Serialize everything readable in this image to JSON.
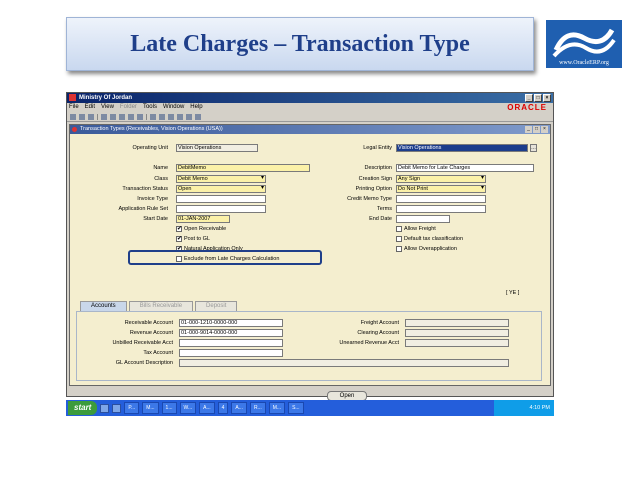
{
  "slide": {
    "title": "Late Charges – Transaction Type",
    "logo_text": "www.OracleERP.org"
  },
  "window": {
    "title": "Ministry Of Jordan",
    "menu": [
      "File",
      "Edit",
      "View",
      "Folder",
      "Tools",
      "Window",
      "Help"
    ],
    "brand": "ORACLE"
  },
  "form": {
    "title": "Transaction Types (Receivables, Vision Operations (USA))",
    "operating_unit": {
      "label": "Operating Unit",
      "value": "Vision Operations"
    },
    "legal_entity": {
      "label": "Legal Entity",
      "value": "Vision Operations"
    },
    "name": {
      "label": "Name",
      "value": "DebitMemo"
    },
    "class": {
      "label": "Class",
      "value": "Debit Memo"
    },
    "transaction_status": {
      "label": "Transaction Status",
      "value": "Open"
    },
    "invoice_type": {
      "label": "Invoice Type",
      "value": ""
    },
    "application_rule_set": {
      "label": "Application Rule Set",
      "value": ""
    },
    "start_date": {
      "label": "Start Date",
      "value": "01-JAN-2007"
    },
    "description": {
      "label": "Description",
      "value": "Debit Memo for Late Charges"
    },
    "creation_sign": {
      "label": "Creation Sign",
      "value": "Any Sign"
    },
    "printing_option": {
      "label": "Printing Option",
      "value": "Do Not Print"
    },
    "credit_memo_type": {
      "label": "Credit Memo Type",
      "value": ""
    },
    "terms": {
      "label": "Terms",
      "value": ""
    },
    "end_date": {
      "label": "End Date",
      "value": ""
    },
    "checkboxes_left": [
      {
        "label": "Open Receivable",
        "checked": "✔"
      },
      {
        "label": "Post to GL",
        "checked": "✔"
      },
      {
        "label": "Natural Application Only",
        "checked": "✔"
      },
      {
        "label": "Exclude from Late Charges Calculation",
        "checked": ""
      }
    ],
    "checkboxes_right": [
      {
        "label": "Allow Freight",
        "checked": ""
      },
      {
        "label": "Default tax classification",
        "checked": ""
      },
      {
        "label": "Allow Overapplication",
        "checked": ""
      }
    ],
    "flex_indicator": "[ YE ]",
    "tabs": [
      "Accounts",
      "Bills Receivable",
      "Deposit"
    ],
    "accounts": {
      "receivable": {
        "label": "Receivable Account",
        "value": "01-000-1210-0000-000"
      },
      "revenue": {
        "label": "Revenue Account",
        "value": "01-000-9014-0000-000"
      },
      "unbilled": {
        "label": "Unbilled Receivable Acct",
        "value": ""
      },
      "tax": {
        "label": "Tax Account",
        "value": ""
      },
      "gl_desc": {
        "label": "GL Account Description",
        "value": ""
      },
      "freight": {
        "label": "Freight Account",
        "value": ""
      },
      "clearing": {
        "label": "Clearing Account",
        "value": ""
      },
      "unearned": {
        "label": "Unearned Revenue Acct",
        "value": ""
      }
    },
    "open_button": "Open"
  },
  "taskbar": {
    "start": "start",
    "items": [
      "P...",
      "M...",
      "1...",
      "W...",
      "A...",
      "4",
      "A...",
      "R...",
      "M...",
      "S..."
    ],
    "clock": "4:10 PM"
  }
}
